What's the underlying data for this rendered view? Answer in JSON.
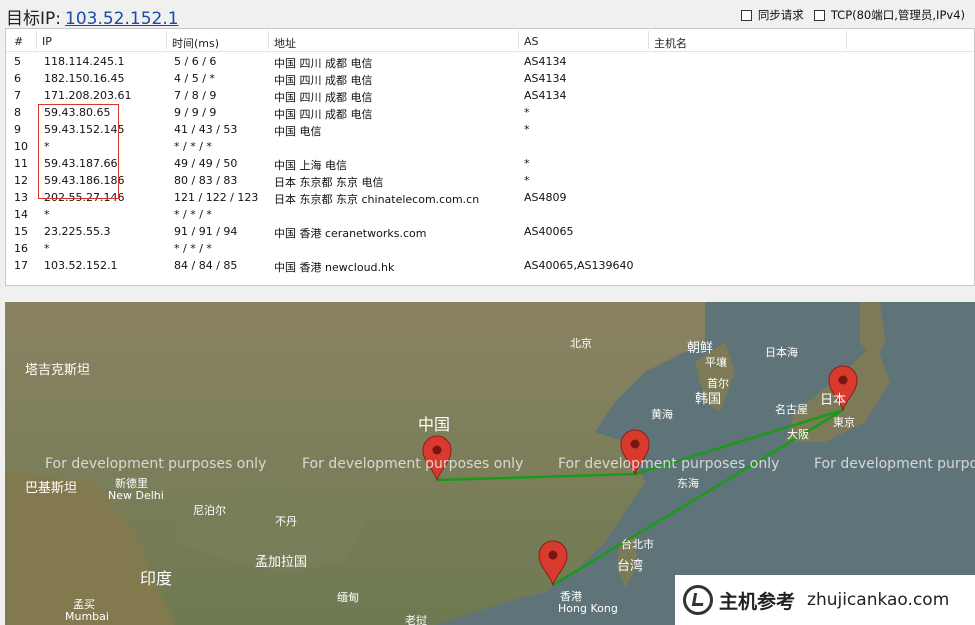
{
  "header": {
    "label": "目标IP:",
    "ip": "103.52.152.1",
    "sync_label": "同步请求",
    "tcp_label": "TCP(80端口,管理员,IPv4)"
  },
  "table": {
    "columns": [
      "#",
      "IP",
      "时间(ms)",
      "地址",
      "AS",
      "主机名"
    ],
    "rows": [
      {
        "hop": "5",
        "ip": "118.114.245.1",
        "time": "5 / 6 / 6",
        "addr": "中国 四川 成都 电信",
        "as": "AS4134"
      },
      {
        "hop": "6",
        "ip": "182.150.16.45",
        "time": "4 / 5 / *",
        "addr": "中国 四川 成都 电信",
        "as": "AS4134"
      },
      {
        "hop": "7",
        "ip": "171.208.203.61",
        "time": "7 / 8 / 9",
        "addr": "中国 四川 成都 电信",
        "as": "AS4134"
      },
      {
        "hop": "8",
        "ip": "59.43.80.65",
        "time": "9 / 9 / 9",
        "addr": "中国 四川 成都 电信",
        "as": "*"
      },
      {
        "hop": "9",
        "ip": "59.43.152.145",
        "time": "41 / 43 / 53",
        "addr": "中国 电信",
        "as": "*"
      },
      {
        "hop": "10",
        "ip": "*",
        "time": "* / * / *",
        "addr": "",
        "as": ""
      },
      {
        "hop": "11",
        "ip": "59.43.187.66",
        "time": "49 / 49 / 50",
        "addr": "中国 上海 电信",
        "as": "*"
      },
      {
        "hop": "12",
        "ip": "59.43.186.186",
        "time": "80 / 83 / 83",
        "addr": "日本 东京都 东京 电信",
        "as": "*"
      },
      {
        "hop": "13",
        "ip": "202.55.27.146",
        "time": "121 / 122 / 123",
        "addr": "日本 东京都 东京 chinatelecom.com.cn",
        "as": "AS4809"
      },
      {
        "hop": "14",
        "ip": "*",
        "time": "* / * / *",
        "addr": "",
        "as": ""
      },
      {
        "hop": "15",
        "ip": "23.225.55.3",
        "time": "91 / 91 / 94",
        "addr": "中国 香港 ceranetworks.com",
        "as": "AS40065"
      },
      {
        "hop": "16",
        "ip": "*",
        "time": "* / * / *",
        "addr": "",
        "as": ""
      },
      {
        "hop": "17",
        "ip": "103.52.152.1",
        "time": "84 / 84 / 85",
        "addr": "中国 香港 newcloud.hk",
        "as": "AS40065,AS139640"
      }
    ]
  },
  "map": {
    "dev_notice": "For development purposes only",
    "labels": {
      "kazakhstan": "塔吉克斯坦",
      "pakistan": "巴基斯坦",
      "new_delhi_cn": "新德里",
      "new_delhi": "New Delhi",
      "nepal": "尼泊尔",
      "bhutan": "不丹",
      "bangladesh": "孟加拉国",
      "india": "印度",
      "mumbai_cn": "孟买",
      "mumbai": "Mumbai",
      "china": "中国",
      "beijing": "北京",
      "yellow_sea": "黄海",
      "east_sea": "东海",
      "korea_north": "朝鲜",
      "pyongyang": "平壤",
      "korea_south": "韩国",
      "seoul": "首尔",
      "sea_of_japan": "日本海",
      "japan": "日本",
      "nagoya": "名古屋",
      "osaka": "大阪",
      "tokyo": "東京",
      "taipei": "台北市",
      "taiwan": "台湾",
      "hongkong_cn": "香港",
      "hongkong": "Hong Kong",
      "myanmar": "缅甸",
      "laos": "老挝"
    }
  },
  "watermark": {
    "brand": "主机参考",
    "domain": "zhujicankao.com",
    "sub": "ZHUJICANKAO.COM"
  },
  "colors": {
    "route_line": "#1a9a1a",
    "pin": "#d83a2e",
    "redbox": "#dd3333",
    "link": "#1a4aa8"
  }
}
